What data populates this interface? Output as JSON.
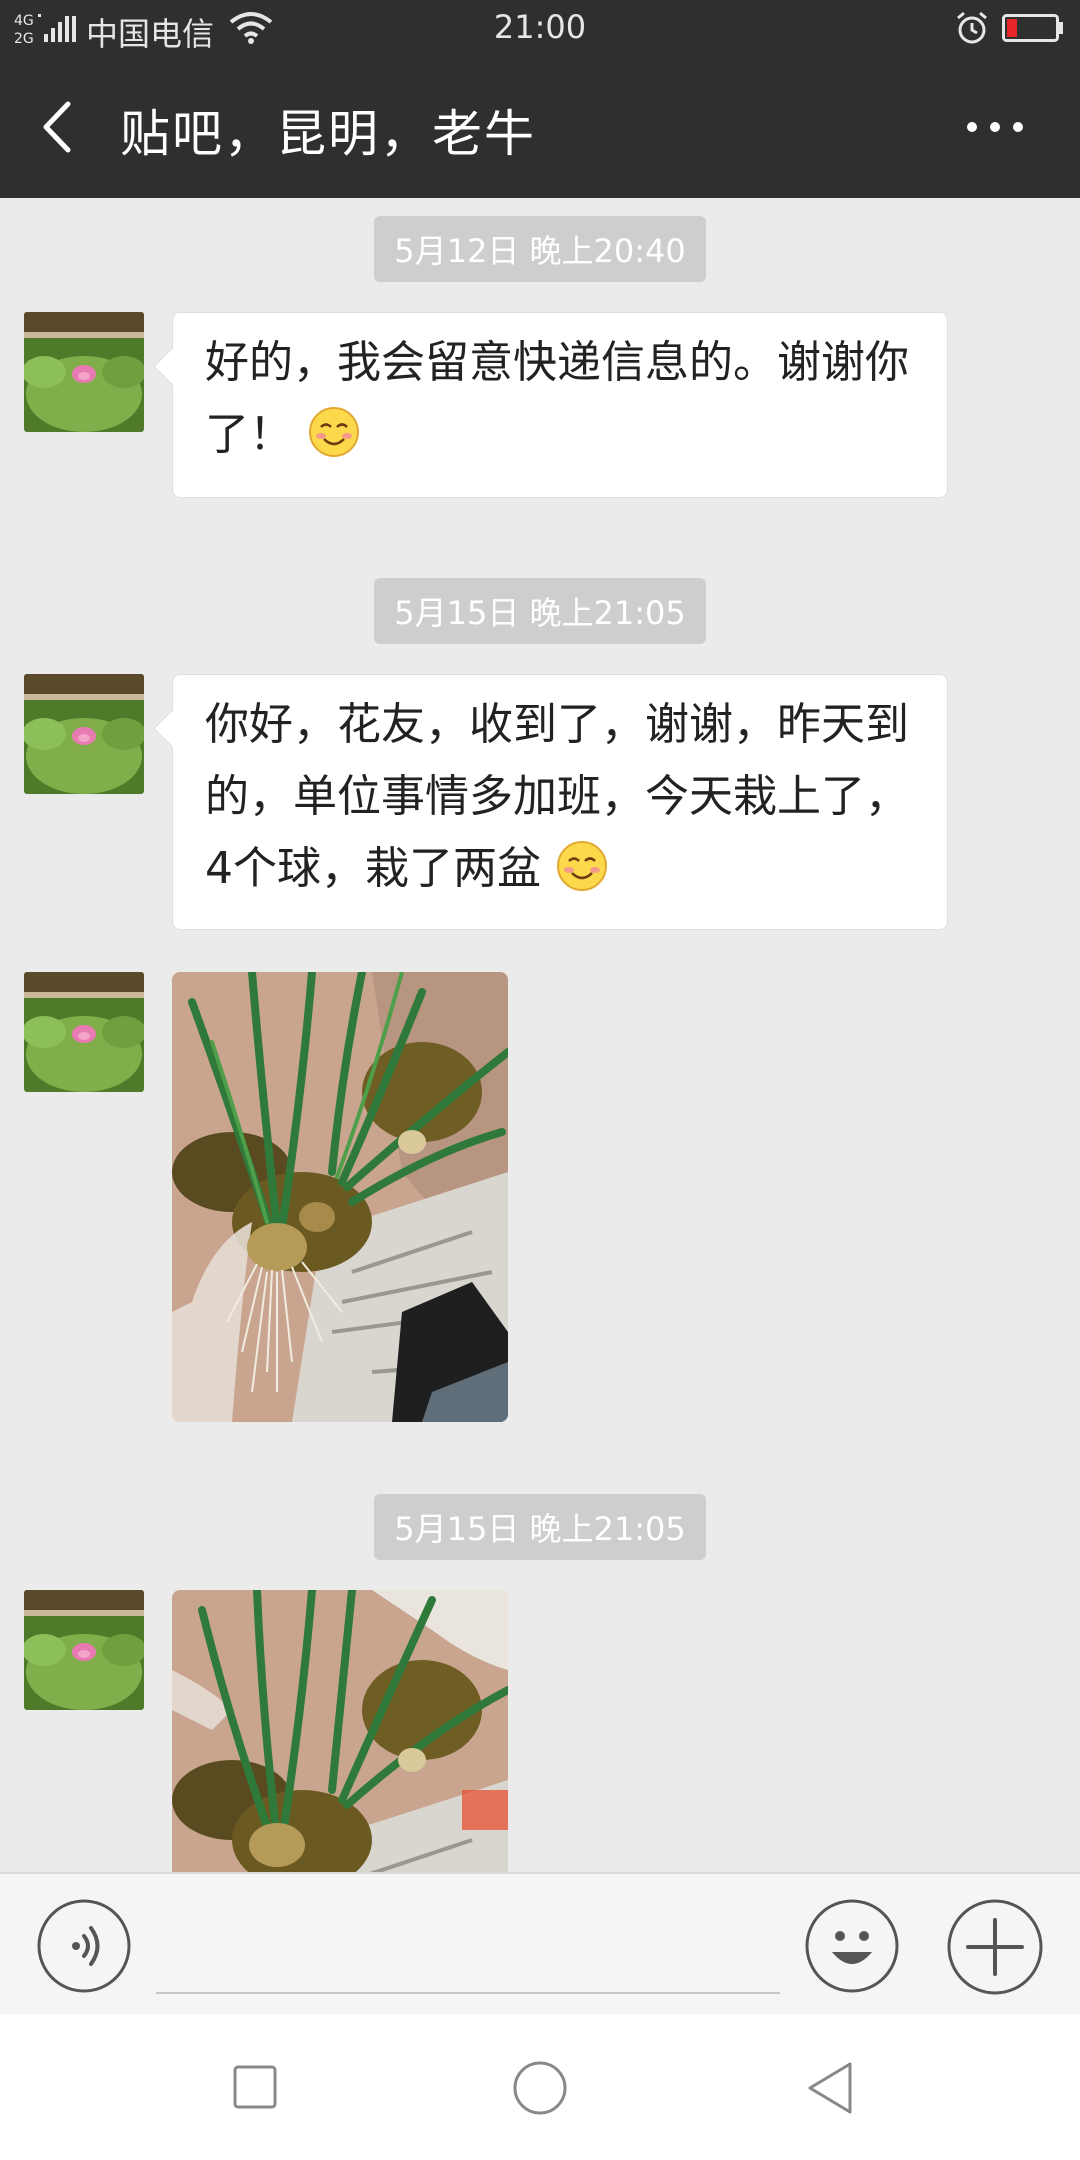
{
  "status_bar": {
    "network": "4G 2G",
    "carrier": "中国电信",
    "time": "21:00"
  },
  "header": {
    "title": "贴吧，昆明，老牛"
  },
  "messages": [
    {
      "type": "timestamp",
      "text": "5月12日 晚上20:40"
    },
    {
      "type": "text",
      "sender": "other",
      "text": "好的，我会留意快递信息的。谢谢你了！",
      "emoji": "smiley-icon"
    },
    {
      "type": "timestamp",
      "text": "5月15日 晚上21:05"
    },
    {
      "type": "text",
      "sender": "other",
      "text": "你好，花友，收到了，谢谢，昨天到的，单位事情多加班，今天栽上了，4个球，栽了两盆",
      "emoji": "smiley-icon"
    },
    {
      "type": "image",
      "sender": "other",
      "content": "photo of plant bulbs with roots"
    },
    {
      "type": "timestamp",
      "text": "5月15日 晚上21:05"
    },
    {
      "type": "image",
      "sender": "other",
      "content": "photo of plant bulbs with roots"
    }
  ],
  "input_bar": {
    "placeholder": "",
    "icons": [
      "voice-icon",
      "emoji-icon",
      "plus-icon"
    ]
  },
  "nav_bar": {
    "icons": [
      "recent-apps-icon",
      "home-icon",
      "back-icon"
    ]
  },
  "colors": {
    "header_bg": "#2f2f2f",
    "chat_bg": "#ebebeb",
    "bubble_bg": "#ffffff",
    "timestamp_bg": "#cecece"
  }
}
